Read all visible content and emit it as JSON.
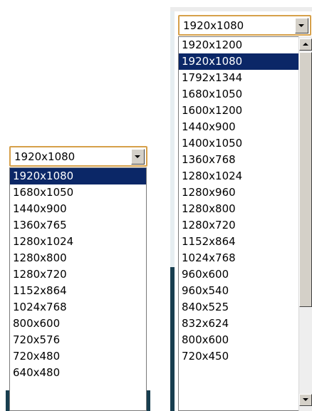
{
  "left_select": {
    "value": "1920x1080",
    "options": [
      "1920x1080",
      "1680x1050",
      "1440x900",
      "1360x765",
      "1280x1024",
      "1280x800",
      "1280x720",
      "1152x864",
      "1024x768",
      "800x600",
      "720x576",
      "720x480",
      "640x480"
    ],
    "selected_index": 0
  },
  "right_select": {
    "value": "1920x1080",
    "options": [
      "1920x1200",
      "1920x1080",
      "1792x1344",
      "1680x1050",
      "1600x1200",
      "1440x900",
      "1400x1050",
      "1360x768",
      "1280x1024",
      "1280x960",
      "1280x800",
      "1280x720",
      "1152x864",
      "1024x768",
      "960x600",
      "960x540",
      "840x525",
      "832x624",
      "800x600",
      "720x450"
    ],
    "selected_index": 1,
    "scroll_position": 0
  },
  "colors": {
    "highlight": "#0b2767",
    "focus_border": "#d6a04a",
    "button_face": "#d4d0c8",
    "background_dark": "#173e4f"
  },
  "icons": {
    "combo_button": "chevron-down-icon",
    "scroll_up": "arrow-up-icon",
    "scroll_down": "arrow-down-icon"
  }
}
